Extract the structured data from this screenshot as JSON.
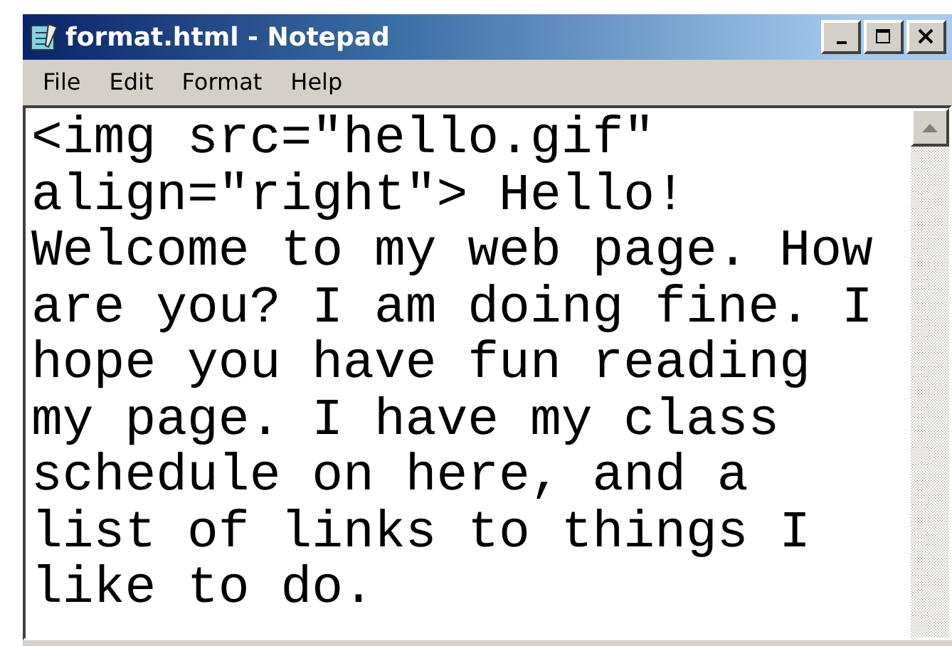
{
  "window": {
    "title": "format.html - Notepad"
  },
  "menu": [
    "File",
    "Edit",
    "Format",
    "Help"
  ],
  "editor": {
    "lines": [
      "<img src=\"hello.gif\"",
      "align=\"right\"> Hello!",
      "Welcome to my web page. How",
      "are you? I am doing fine. I",
      "hope you have fun reading",
      "my page. I have my class",
      "schedule on here, and a",
      "list of links to things I",
      "like to do."
    ]
  }
}
